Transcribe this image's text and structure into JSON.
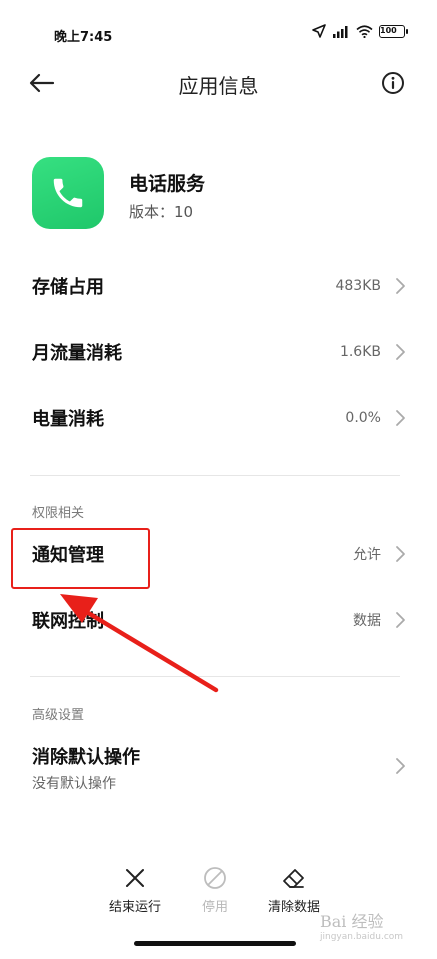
{
  "status_bar": {
    "time": "晚上7:45",
    "battery": "100"
  },
  "header": {
    "title": "应用信息",
    "back_icon": "arrow-left-icon",
    "info_icon": "info-circle-icon"
  },
  "app": {
    "name": "电话服务",
    "version": "版本：10",
    "icon": "phone-icon",
    "icon_color": "#22cc6e"
  },
  "usage_rows": [
    {
      "label": "存储占用",
      "value": "483KB"
    },
    {
      "label": "月流量消耗",
      "value": "1.6KB"
    },
    {
      "label": "电量消耗",
      "value": "0.0%"
    }
  ],
  "permissions": {
    "section_title": "权限相关",
    "rows": [
      {
        "label": "通知管理",
        "value": "允许"
      },
      {
        "label": "联网控制",
        "value": "数据"
      }
    ]
  },
  "advanced": {
    "section_title": "高级设置",
    "clear_default": {
      "label": "消除默认操作",
      "sub": "没有默认操作"
    }
  },
  "actions": {
    "stop": "结束运行",
    "disable": "停用",
    "clear_data": "清除数据"
  },
  "annotation": {
    "highlight_color": "#e8201a"
  },
  "watermark": {
    "main": "Bai 经验",
    "sub": "jingyan.baidu.com"
  }
}
